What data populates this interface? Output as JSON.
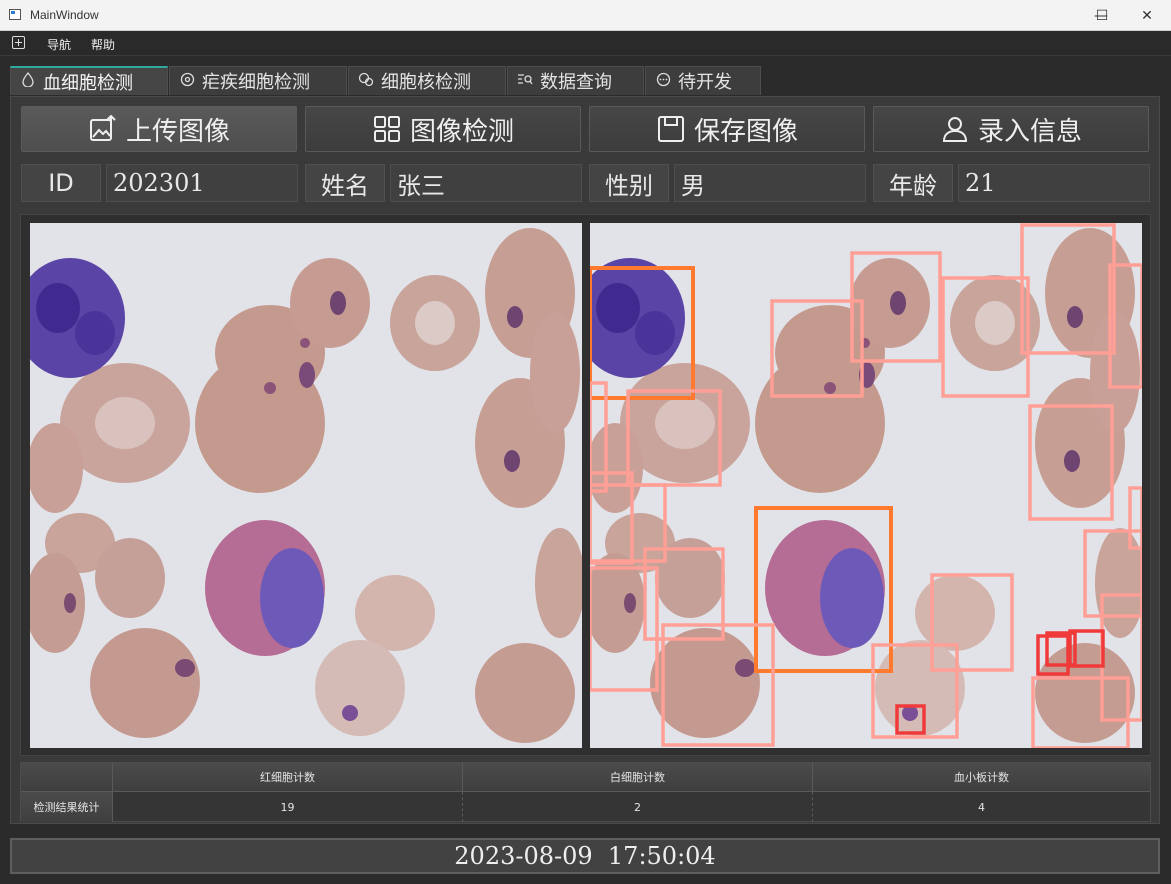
{
  "window": {
    "title": "MainWindow",
    "controls": {
      "minimize": "—",
      "maximize": "☐",
      "close": "✕"
    }
  },
  "menubar": {
    "items": [
      "导航",
      "帮助"
    ]
  },
  "tabs": [
    {
      "label": "血细胞检测",
      "icon": "droplet-icon",
      "active": true
    },
    {
      "label": "疟疾细胞检测",
      "icon": "target-icon",
      "active": false
    },
    {
      "label": "细胞核检测",
      "icon": "cells-icon",
      "active": false
    },
    {
      "label": "数据查询",
      "icon": "search-list-icon",
      "active": false
    },
    {
      "label": "待开发",
      "icon": "more-icon",
      "active": false
    }
  ],
  "actions": {
    "upload": "上传图像",
    "detect": "图像检测",
    "save": "保存图像",
    "enter": "录入信息"
  },
  "patient": {
    "id_label": "ID",
    "id_value": "202301",
    "name_label": "姓名",
    "name_value": "张三",
    "gender_label": "性别",
    "gender_value": "男",
    "age_label": "年龄",
    "age_value": "21"
  },
  "colors": {
    "rbc_box": "#ff9f96",
    "wbc_box": "#ff7a2f",
    "platelet_box": "#f03a3a",
    "accent_tab": "#2ea9a0"
  },
  "stats": {
    "headers": [
      "红细胞计数",
      "白细胞计数",
      "血小板计数"
    ],
    "row_label": "检测结果统计",
    "values": [
      "19",
      "2",
      "4"
    ]
  },
  "status": {
    "datetime": "2023-08-09  17:50:04"
  }
}
